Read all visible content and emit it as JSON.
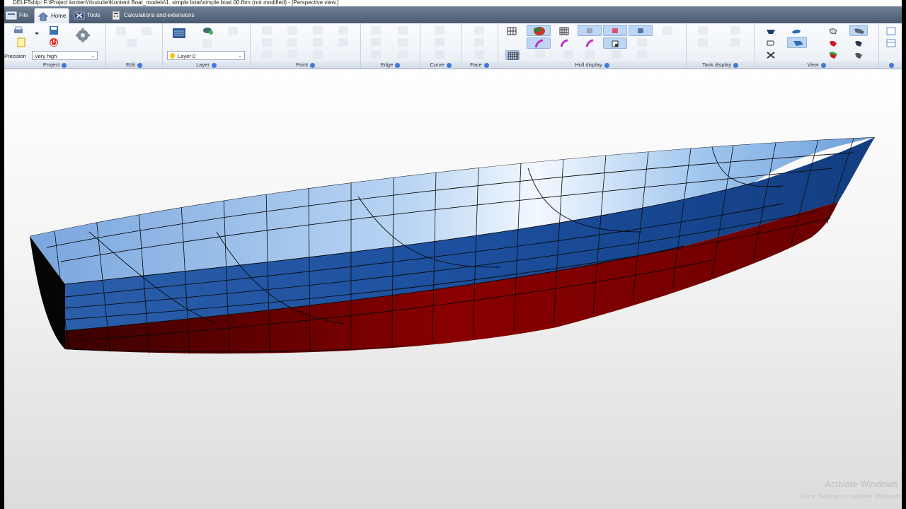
{
  "window": {
    "title": "DELFTship: F:\\Project konten\\Youtube\\Kontent Boat_models\\1. simple boat\\simple boat 00.fbm (not modified) - [Perspective view.]"
  },
  "tabs": [
    {
      "label": "File"
    },
    {
      "label": "Home",
      "active": true
    },
    {
      "label": "Tools"
    },
    {
      "label": "Calculations and extensions"
    }
  ],
  "project": {
    "precision_label": "Precision",
    "precision_value": "Very high"
  },
  "layer": {
    "value": "Layer 0"
  },
  "groups": [
    {
      "label": "Project"
    },
    {
      "label": "Edit"
    },
    {
      "label": "Layer"
    },
    {
      "label": "Point"
    },
    {
      "label": "Edge"
    },
    {
      "label": "Curve"
    },
    {
      "label": "Face"
    },
    {
      "label": "Hull display"
    },
    {
      "label": "Tank display"
    },
    {
      "label": "View"
    }
  ],
  "colors": {
    "hull_topside": "#1f4f9a",
    "hull_bottom": "#8a0000",
    "deck": "#9fc4ef",
    "ribbon_tab_bar": "#5a6a80",
    "accent": "#3f7ad6"
  },
  "watermark": {
    "line1": "Activate Windows",
    "line2": "Go to Settings to activate Windows."
  }
}
